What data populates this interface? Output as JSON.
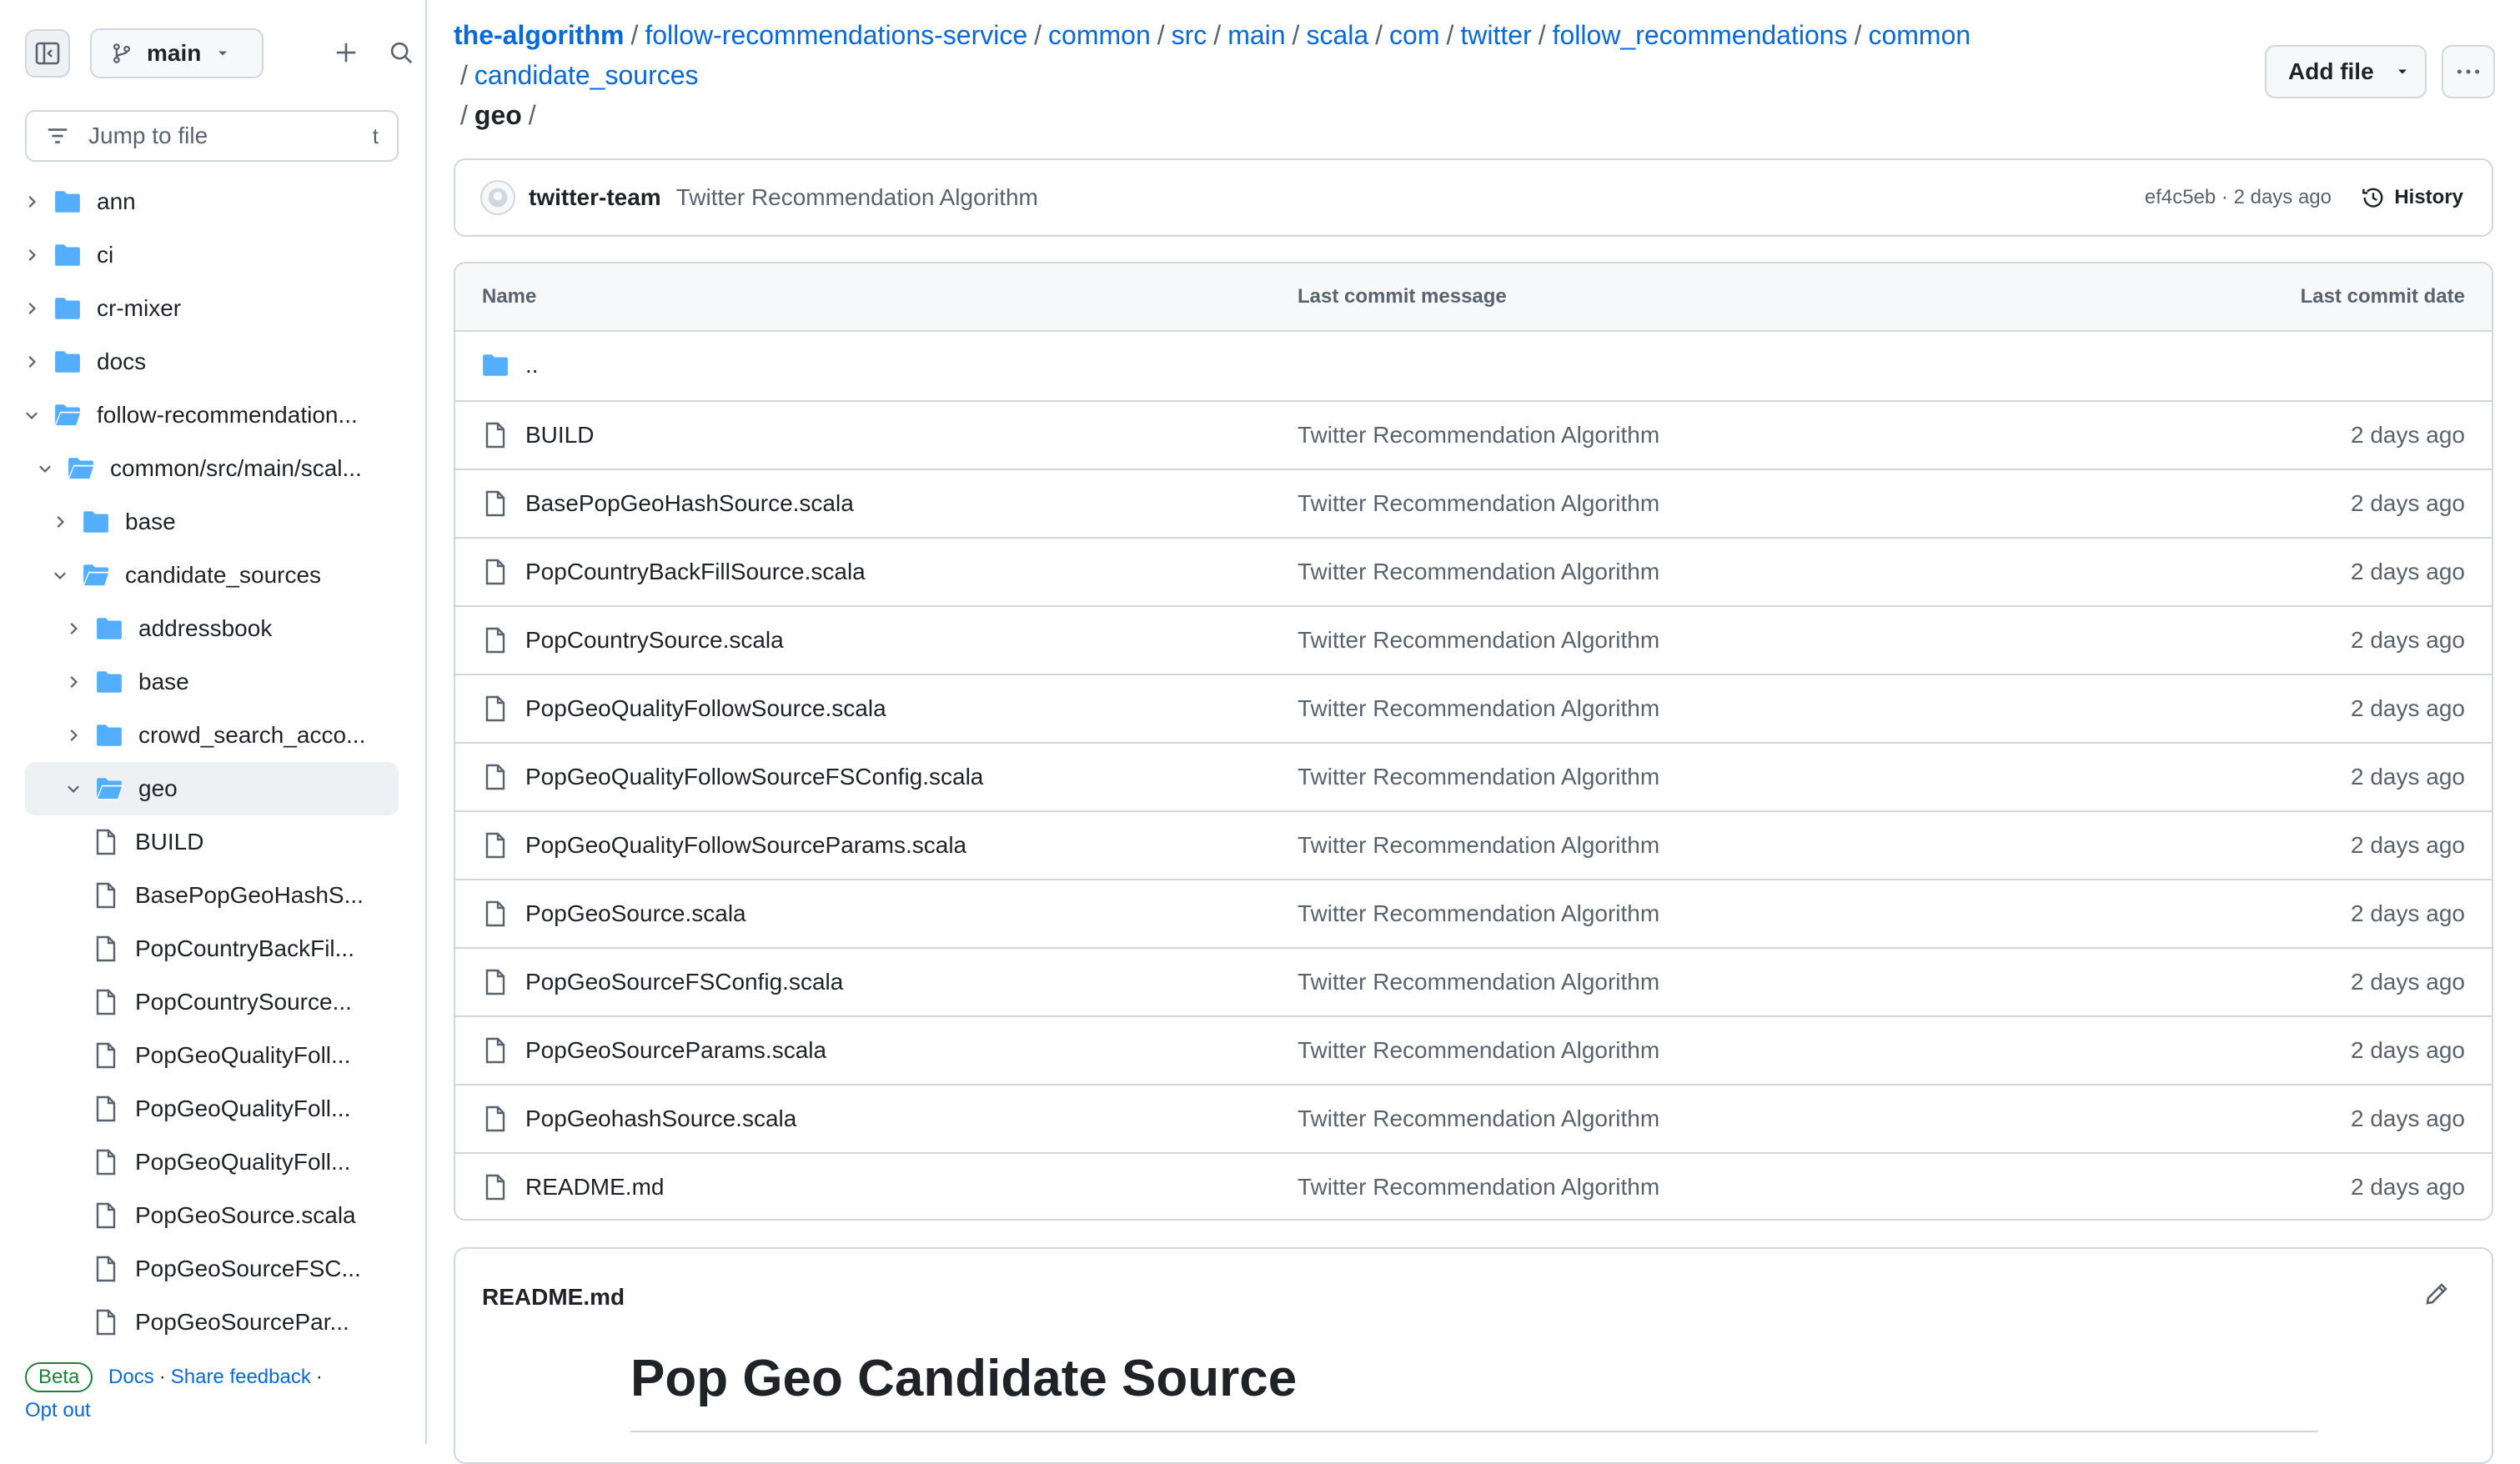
{
  "sidebar": {
    "branch": "main",
    "jump_placeholder": "Jump to file",
    "jump_kbd": "t",
    "tree": [
      {
        "label": "ann",
        "kind": "folder",
        "level": 0,
        "expanded": false
      },
      {
        "label": "ci",
        "kind": "folder",
        "level": 0,
        "expanded": false
      },
      {
        "label": "cr-mixer",
        "kind": "folder",
        "level": 0,
        "expanded": false
      },
      {
        "label": "docs",
        "kind": "folder",
        "level": 0,
        "expanded": false
      },
      {
        "label": "follow-recommendation...",
        "kind": "folder",
        "level": 0,
        "expanded": true
      },
      {
        "label": "common/src/main/scal...",
        "kind": "folder",
        "level": 1,
        "expanded": true
      },
      {
        "label": "base",
        "kind": "folder",
        "level": 2,
        "expanded": false
      },
      {
        "label": "candidate_sources",
        "kind": "folder",
        "level": 2,
        "expanded": true
      },
      {
        "label": "addressbook",
        "kind": "folder",
        "level": 3,
        "expanded": false
      },
      {
        "label": "base",
        "kind": "folder",
        "level": 3,
        "expanded": false
      },
      {
        "label": "crowd_search_acco...",
        "kind": "folder",
        "level": 3,
        "expanded": false
      },
      {
        "label": "geo",
        "kind": "folder",
        "level": 3,
        "expanded": true,
        "selected": true
      },
      {
        "label": "BUILD",
        "kind": "file",
        "level": 4
      },
      {
        "label": "BasePopGeoHashS...",
        "kind": "file",
        "level": 4
      },
      {
        "label": "PopCountryBackFil...",
        "kind": "file",
        "level": 4
      },
      {
        "label": "PopCountrySource...",
        "kind": "file",
        "level": 4
      },
      {
        "label": "PopGeoQualityFoll...",
        "kind": "file",
        "level": 4
      },
      {
        "label": "PopGeoQualityFoll...",
        "kind": "file",
        "level": 4
      },
      {
        "label": "PopGeoQualityFoll...",
        "kind": "file",
        "level": 4
      },
      {
        "label": "PopGeoSource.scala",
        "kind": "file",
        "level": 4
      },
      {
        "label": "PopGeoSourceFSC...",
        "kind": "file",
        "level": 4
      },
      {
        "label": "PopGeoSourcePar...",
        "kind": "file",
        "level": 4
      }
    ],
    "footer": {
      "beta": "Beta",
      "docs": "Docs",
      "feedback": "Share feedback",
      "optout": "Opt out"
    }
  },
  "breadcrumb": {
    "items": [
      "the-algorithm",
      "follow-recommendations-service",
      "common",
      "src",
      "main",
      "scala",
      "com",
      "twitter",
      "follow_recommendations",
      "common",
      "candidate_sources"
    ],
    "current": "geo"
  },
  "actions": {
    "add_file": "Add file"
  },
  "commit": {
    "author": "twitter-team",
    "message": "Twitter Recommendation Algorithm",
    "meta": "ef4c5eb · 2 days ago",
    "history": "History"
  },
  "table": {
    "headers": {
      "name": "Name",
      "message": "Last commit message",
      "date": "Last commit date"
    },
    "parent": "..",
    "rows": [
      {
        "name": "BUILD",
        "message": "Twitter Recommendation Algorithm",
        "date": "2 days ago"
      },
      {
        "name": "BasePopGeoHashSource.scala",
        "message": "Twitter Recommendation Algorithm",
        "date": "2 days ago"
      },
      {
        "name": "PopCountryBackFillSource.scala",
        "message": "Twitter Recommendation Algorithm",
        "date": "2 days ago"
      },
      {
        "name": "PopCountrySource.scala",
        "message": "Twitter Recommendation Algorithm",
        "date": "2 days ago"
      },
      {
        "name": "PopGeoQualityFollowSource.scala",
        "message": "Twitter Recommendation Algorithm",
        "date": "2 days ago"
      },
      {
        "name": "PopGeoQualityFollowSourceFSConfig.scala",
        "message": "Twitter Recommendation Algorithm",
        "date": "2 days ago"
      },
      {
        "name": "PopGeoQualityFollowSourceParams.scala",
        "message": "Twitter Recommendation Algorithm",
        "date": "2 days ago"
      },
      {
        "name": "PopGeoSource.scala",
        "message": "Twitter Recommendation Algorithm",
        "date": "2 days ago"
      },
      {
        "name": "PopGeoSourceFSConfig.scala",
        "message": "Twitter Recommendation Algorithm",
        "date": "2 days ago"
      },
      {
        "name": "PopGeoSourceParams.scala",
        "message": "Twitter Recommendation Algorithm",
        "date": "2 days ago"
      },
      {
        "name": "PopGeohashSource.scala",
        "message": "Twitter Recommendation Algorithm",
        "date": "2 days ago"
      },
      {
        "name": "README.md",
        "message": "Twitter Recommendation Algorithm",
        "date": "2 days ago"
      }
    ]
  },
  "readme": {
    "title": "README.md",
    "heading": "Pop Geo Candidate Source"
  },
  "colors": {
    "link": "#0969da",
    "folder": "#54aeff",
    "border": "#d0d7de",
    "muted": "#59636e"
  }
}
